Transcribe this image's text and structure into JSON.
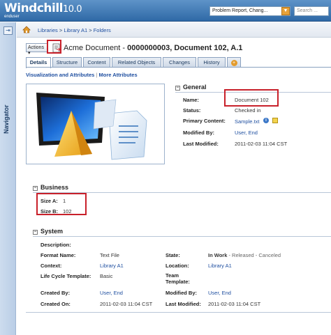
{
  "app": {
    "logo": "Windchill",
    "version": "10.0",
    "user": "enduser",
    "search_type": "Problem Report, Chang...",
    "search_placeholder": "Search ..."
  },
  "navigator": {
    "label": "Navigator"
  },
  "breadcrumb": [
    "Libraries",
    "Library A1",
    "Folders"
  ],
  "breadcrumb_sep": ">",
  "toolbar": {
    "actions_label": "Actions"
  },
  "title": {
    "prefix": "Acme Document - ",
    "main": "0000000003, Document 102, A.1"
  },
  "tabs": [
    "Details",
    "Structure",
    "Content",
    "Related Objects",
    "Changes",
    "History"
  ],
  "subnav": [
    "Visualization and Attributes",
    "More Attributes"
  ],
  "subnav_sep": "|",
  "general": {
    "title": "General",
    "fields": [
      {
        "label": "Name:",
        "value": "Document 102"
      },
      {
        "label": "Status:",
        "value": "Checked in"
      },
      {
        "label": "Primary Content:",
        "value": "Sample.txt"
      },
      {
        "label": "Modified By:",
        "value": "User, End"
      },
      {
        "label": "Last Modified:",
        "value": "2011-02-03 11:04 CST"
      }
    ]
  },
  "business": {
    "title": "Business",
    "fields": [
      {
        "label": "Size A:",
        "value": "1"
      },
      {
        "label": "Size B:",
        "value": "102"
      }
    ]
  },
  "system": {
    "title": "System",
    "description_label": "Description:",
    "left": [
      {
        "label": "Format Name:",
        "value": "Text File"
      },
      {
        "label": "Context:",
        "value": "Library A1"
      },
      {
        "label": "Life Cycle Template:",
        "value": "Basic"
      },
      {
        "label": "Created By:",
        "value": "User, End"
      },
      {
        "label": "Created On:",
        "value": "2011-02-03 11:04 CST"
      }
    ],
    "right": [
      {
        "label": "State:",
        "value": "In Work",
        "extra": " - Released - Canceled"
      },
      {
        "label": "Location:",
        "value": "Library A1"
      },
      {
        "label": "Team Template:",
        "value": ""
      },
      {
        "label": "Modified By:",
        "value": "User, End"
      },
      {
        "label": "Last Modified:",
        "value": "2011-02-03 11:04 CST"
      }
    ]
  },
  "colors": {
    "header": "#3d76b3",
    "highlight": "#c8202a",
    "link": "#1f4fa0"
  }
}
